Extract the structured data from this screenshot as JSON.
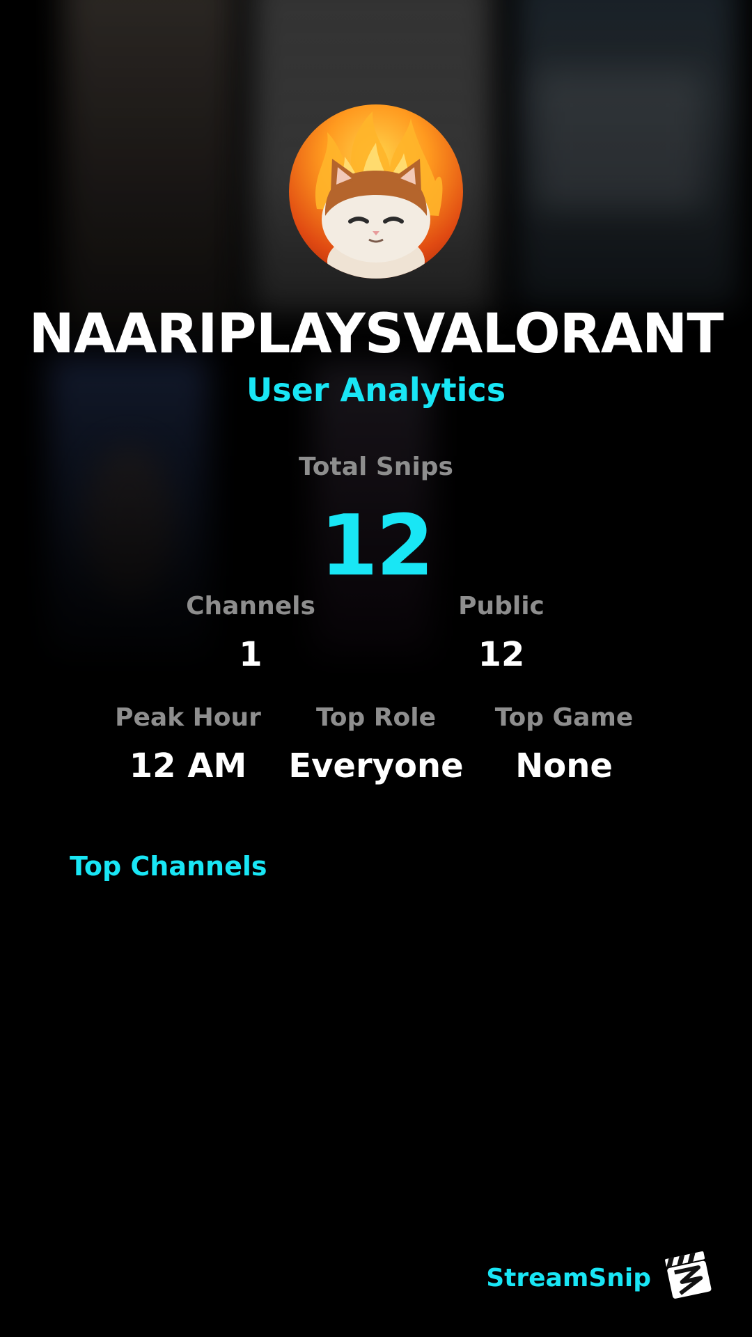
{
  "profile": {
    "username": "NAARIPLAYSVALORANT",
    "subtitle": "User Analytics",
    "avatar_icon": "fire-cat-avatar"
  },
  "stats": {
    "total_snips_label": "Total Snips",
    "total_snips_value": "12",
    "channels_label": "Channels",
    "channels_value": "1",
    "public_label": "Public",
    "public_value": "12",
    "peak_hour_label": "Peak Hour",
    "peak_hour_value": "12 AM",
    "top_role_label": "Top Role",
    "top_role_value": "Everyone",
    "top_game_label": "Top Game",
    "top_game_value": "None"
  },
  "top_channels": {
    "title": "Top Channels",
    "items": []
  },
  "footer": {
    "brand": "StreamSnip",
    "logo_icon": "clapperboard-logo-icon"
  },
  "colors": {
    "accent": "#19e6f5",
    "label": "#8e8e8e",
    "background": "#000000"
  }
}
